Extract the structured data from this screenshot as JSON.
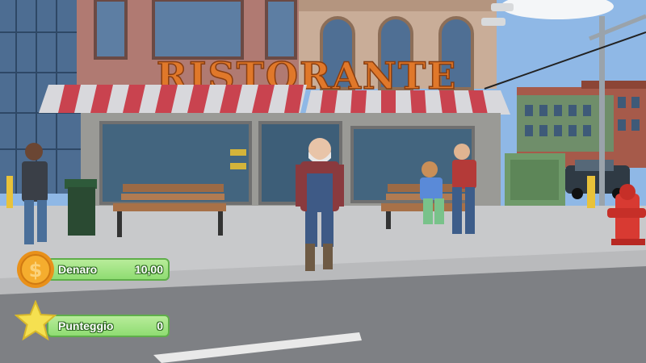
{
  "sign": {
    "text": "RISTORANTE"
  },
  "hud": {
    "money": {
      "label": "Denaro",
      "value": "10,00",
      "icon": "dollar-coin-icon"
    },
    "score": {
      "label": "Punteggio",
      "value": "0",
      "icon": "star-icon"
    }
  },
  "colors": {
    "hud_green": "#8fdc72",
    "sign_orange": "#e0782a",
    "coin_gold": "#f0a020",
    "star_yellow": "#f5e050"
  }
}
